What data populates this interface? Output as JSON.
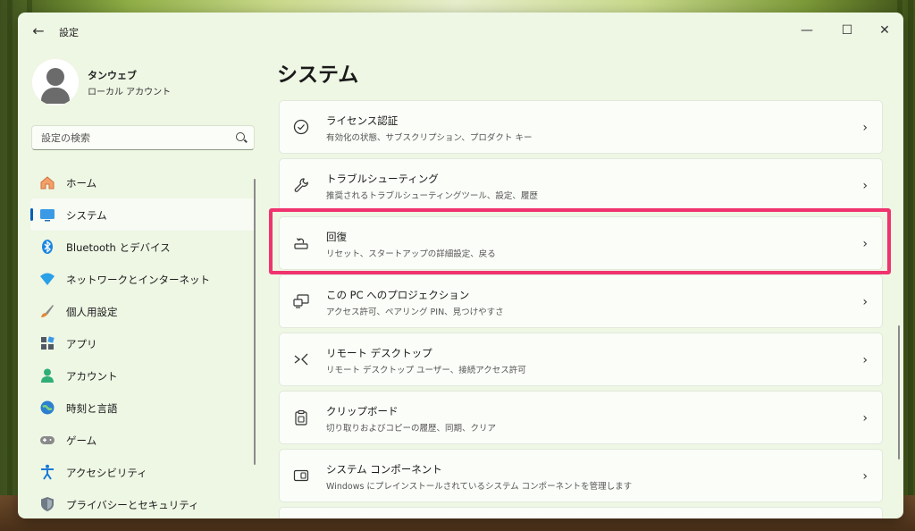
{
  "window": {
    "title": "設定",
    "back_icon": "←",
    "minimize_icon": "—",
    "maximize_icon": "☐",
    "close_icon": "✕"
  },
  "profile": {
    "name": "タンウェブ",
    "account_type": "ローカル アカウント"
  },
  "search": {
    "placeholder": "設定の検索"
  },
  "nav": {
    "items": [
      {
        "label": "ホーム",
        "icon": "home-icon",
        "color": "#e07b3a"
      },
      {
        "label": "システム",
        "icon": "system-icon",
        "color": "#2a8bd6",
        "selected": true
      },
      {
        "label": "Bluetooth とデバイス",
        "icon": "bluetooth-icon",
        "color": "#1a86e0"
      },
      {
        "label": "ネットワークとインターネット",
        "icon": "network-icon",
        "color": "#2aa0e8"
      },
      {
        "label": "個人用設定",
        "icon": "brush-icon",
        "color": "#d07030"
      },
      {
        "label": "アプリ",
        "icon": "apps-icon",
        "color": "#505a66"
      },
      {
        "label": "アカウント",
        "icon": "account-icon",
        "color": "#2fae78"
      },
      {
        "label": "時刻と言語",
        "icon": "time-language-icon",
        "color": "#2a7fd0"
      },
      {
        "label": "ゲーム",
        "icon": "gaming-icon",
        "color": "#777"
      },
      {
        "label": "アクセシビリティ",
        "icon": "accessibility-icon",
        "color": "#1a7ad8"
      },
      {
        "label": "プライバシーとセキュリティ",
        "icon": "shield-icon",
        "color": "#6f7a85"
      }
    ]
  },
  "main": {
    "title": "システム",
    "cards": [
      {
        "title": "ライセンス認証",
        "subtitle": "有効化の状態、サブスクリプション、プロダクト キー",
        "icon": "check-circle-icon"
      },
      {
        "title": "トラブルシューティング",
        "subtitle": "推奨されるトラブルシューティングツール、設定、履歴",
        "icon": "wrench-icon"
      },
      {
        "title": "回復",
        "subtitle": "リセット、スタートアップの詳細設定、戻る",
        "icon": "recovery-icon",
        "highlighted": true
      },
      {
        "title": "この PC へのプロジェクション",
        "subtitle": "アクセス許可、ペアリング PIN、見つけやすさ",
        "icon": "projection-icon"
      },
      {
        "title": "リモート デスクトップ",
        "subtitle": "リモート デスクトップ ユーザー、接続アクセス許可",
        "icon": "remote-desktop-icon"
      },
      {
        "title": "クリップボード",
        "subtitle": "切り取りおよびコピーの履歴、同期、クリア",
        "icon": "clipboard-icon"
      },
      {
        "title": "システム コンポーネント",
        "subtitle": "Windows にプレインストールされているシステム コンポーネントを管理します",
        "icon": "component-icon"
      }
    ],
    "chevron": "›",
    "highlight_color": "#f0336e"
  }
}
